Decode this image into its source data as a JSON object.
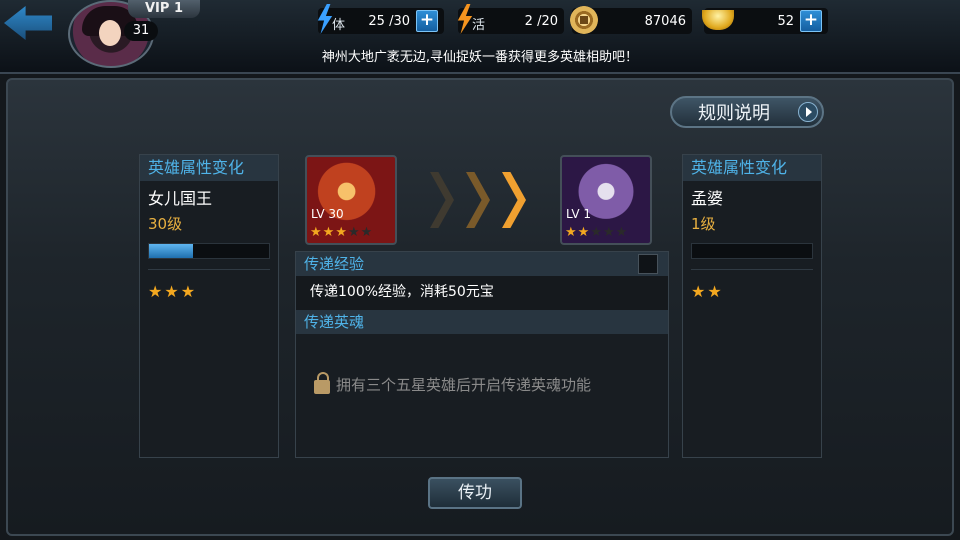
{
  "player": {
    "vip": "VIP 1",
    "level": "31"
  },
  "resources": {
    "stamina": {
      "label": "体",
      "value": "25 /30"
    },
    "activity": {
      "label": "活",
      "value": "2 /20"
    },
    "coins": {
      "value": "87046"
    },
    "gold": {
      "value": "52"
    }
  },
  "ticker": "神州大地广袤无边,寻仙捉妖一番获得更多英雄相助吧！",
  "rules_button": "规则说明",
  "source_hero": {
    "panel_title": "英雄属性变化",
    "name": "女儿国王",
    "level_text": "30级",
    "exp_fraction": 0.37,
    "stars": 3,
    "card_level": "LV 30",
    "card_stars": 3,
    "card_star_slots": 5
  },
  "target_hero": {
    "panel_title": "英雄属性变化",
    "name": "孟婆",
    "level_text": "1级",
    "exp_fraction": 0,
    "stars": 2,
    "card_level": "LV 1",
    "card_stars": 2,
    "card_star_slots": 5
  },
  "transfer_exp": {
    "title": "传递经验",
    "description": "传递100%经验，消耗50元宝"
  },
  "transfer_soul": {
    "title": "传递英魂",
    "locked_message": "拥有三个五星英雄后开启传递英魂功能"
  },
  "transfer_button": "传功",
  "colors": {
    "accent_blue": "#4fb3e8",
    "level_gold": "#e8b040",
    "star": "#f3a820",
    "chevron": "#f0a030"
  }
}
